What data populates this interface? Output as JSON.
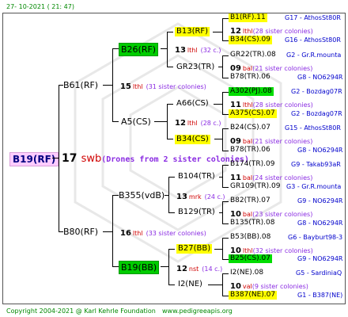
{
  "header": {
    "date": "27- 10-2021 ( 21: 47)"
  },
  "footer": {
    "copyright": "Copyright 2004-2021 @ Karl Kehrle Foundation",
    "site": "www.pedigreeapis.org"
  },
  "root": {
    "name": "B19(RF)",
    "num": "17",
    "gen": "swb",
    "note": "(Drones from 2 sister colonies)"
  },
  "gen1": {
    "upper": "B61(RF)",
    "lower": "B80(RF)"
  },
  "gen2": {
    "upper": {
      "num": "15",
      "gen": "lthl",
      "sis": "(31 sister colonies)"
    },
    "lower": {
      "num": "16",
      "gen": "lthl",
      "sis": "(33 sister colonies)"
    }
  },
  "gen3": {
    "b26": "B26(RF)",
    "a5": "A5(CS)",
    "b355": "B355(vdB)",
    "b19bb": "B19(BB)"
  },
  "gen4": {
    "g1": {
      "num": "13",
      "gen": "lthl",
      "sis": "(32 c.)",
      "top": "B13(RF)",
      "bot": "GR23(TR)"
    },
    "g2": {
      "num": "12",
      "gen": "lthl",
      "sis": "(28 c.)",
      "top": "A66(CS)",
      "bot": "B34(CS)"
    },
    "g3": {
      "num": "13",
      "gen": "mrk",
      "sis": "(24 c.)",
      "top": "B104(TR)",
      "bot": "B129(TR)"
    },
    "g4": {
      "num": "12",
      "gen": "nst",
      "sis": "(14 c.)",
      "top": "B27(BB)",
      "bot": "I2(NE)"
    }
  },
  "ancestors": [
    {
      "top": "B1(RF).11",
      "topLoc": "G17 - AthosSt80R",
      "num": "12",
      "gen": "lthl",
      "sis": "(28 sister colonies)",
      "bot": "B34(CS).09",
      "botLoc": "G16 - AthosSt80R"
    },
    {
      "top": "GR22(TR).08",
      "topLoc": "G2 - Gr.R.mounta",
      "num": "09",
      "gen": "bal",
      "sis": "(21 sister colonies)",
      "bot": "B78(TR).06",
      "botLoc": "G8 - NO6294R"
    },
    {
      "top": "A302(PJ).08",
      "topLoc": "G2 - Bozdag07R",
      "num": "11",
      "gen": "lthl",
      "sis": "(28 sister colonies)",
      "bot": "A375(CS).07",
      "botLoc": "G2 - Bozdag07R"
    },
    {
      "top": "B24(CS).07",
      "topLoc": "G15 - AthosSt80R",
      "num": "09",
      "gen": "bal",
      "sis": "(21 sister colonies)",
      "bot": "B78(TR).06",
      "botLoc": "G8 - NO6294R"
    },
    {
      "top": "B174(TR).09",
      "topLoc": "G9 - Takab93aR",
      "num": "11",
      "gen": "bal",
      "sis": "(24 sister colonies)",
      "bot": "GR109(TR).09",
      "botLoc": "G3 - Gr.R.mounta"
    },
    {
      "top": "B82(TR).07",
      "topLoc": "G9 - NO6294R",
      "num": "10",
      "gen": "bal",
      "sis": "(23 sister colonies)",
      "bot": "B135(TR).08",
      "botLoc": "G8 - NO6294R"
    },
    {
      "top": "B53(BB).08",
      "topLoc": "G6 - Bayburt98-3",
      "num": "10",
      "gen": "lthl",
      "sis": "(32 sister colonies)",
      "bot": "B25(CS).07",
      "botLoc": "G9 - NO6294R"
    },
    {
      "top": "I2(NE).08",
      "topLoc": "G5 - SardiniaQ",
      "num": "10",
      "gen": "val",
      "sis": "(9 sister colonies)",
      "bot": "B387(NE).07",
      "botLoc": "G1 - B387(NE)"
    }
  ]
}
